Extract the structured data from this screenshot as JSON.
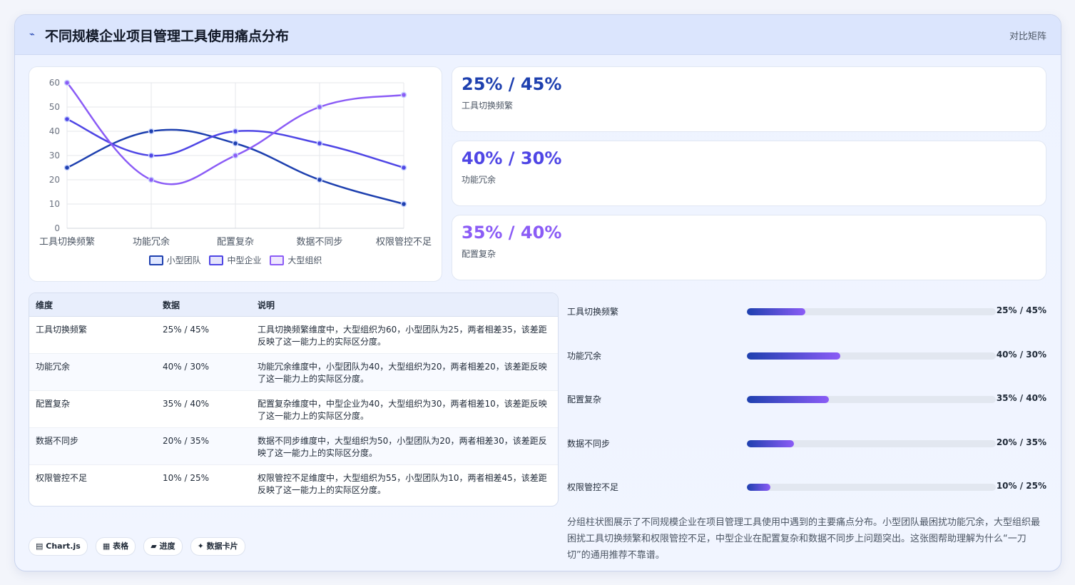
{
  "header": {
    "icon": "⌁",
    "title": "不同规模企业项目管理工具使用痛点分布",
    "right_label": "对比矩阵"
  },
  "chart_data": {
    "type": "line",
    "categories": [
      "工具切换频繁",
      "功能冗余",
      "配置复杂",
      "数据不同步",
      "权限管控不足"
    ],
    "series": [
      {
        "name": "小型团队",
        "values": [
          25,
          40,
          35,
          20,
          10
        ],
        "color": "#1e40af"
      },
      {
        "name": "中型企业",
        "values": [
          45,
          30,
          40,
          35,
          25
        ],
        "color": "#4f46e5"
      },
      {
        "name": "大型组织",
        "values": [
          60,
          20,
          30,
          50,
          55
        ],
        "color": "#8b5cf6"
      }
    ],
    "ylim": [
      0,
      60
    ],
    "yticks": [
      "0",
      "10",
      "20",
      "30",
      "40",
      "50",
      "60"
    ],
    "grid": true,
    "smooth": true,
    "legend_position": "bottom"
  },
  "stats": [
    {
      "value": "25% / 45%",
      "label": "工具切换频繁",
      "color": "#1e40af"
    },
    {
      "value": "40% / 30%",
      "label": "功能冗余",
      "color": "#4f46e5"
    },
    {
      "value": "35% / 40%",
      "label": "配置复杂",
      "color": "#8b5cf6"
    }
  ],
  "table": {
    "headers": [
      "维度",
      "数据",
      "说明"
    ],
    "rows": [
      {
        "dim": "工具切换频繁",
        "data": "25% / 45%",
        "desc": "工具切换频繁维度中，大型组织为60，小型团队为25，两者相差35，该差距反映了这一能力上的实际区分度。"
      },
      {
        "dim": "功能冗余",
        "data": "40% / 30%",
        "desc": "功能冗余维度中，小型团队为40，大型组织为20，两者相差20，该差距反映了这一能力上的实际区分度。"
      },
      {
        "dim": "配置复杂",
        "data": "35% / 40%",
        "desc": "配置复杂维度中，中型企业为40，大型组织为30，两者相差10，该差距反映了这一能力上的实际区分度。"
      },
      {
        "dim": "数据不同步",
        "data": "20% / 35%",
        "desc": "数据不同步维度中，大型组织为50，小型团队为20，两者相差30，该差距反映了这一能力上的实际区分度。"
      },
      {
        "dim": "权限管控不足",
        "data": "10% / 25%",
        "desc": "权限管控不足维度中，大型组织为55，小型团队为10，两者相差45，该差距反映了这一能力上的实际区分度。"
      }
    ]
  },
  "progress": [
    {
      "label": "工具切换频繁",
      "value": "25% / 45%",
      "fill": 0.235
    },
    {
      "label": "功能冗余",
      "value": "40% / 30%",
      "fill": 0.375
    },
    {
      "label": "配置复杂",
      "value": "35% / 40%",
      "fill": 0.33
    },
    {
      "label": "数据不同步",
      "value": "20% / 35%",
      "fill": 0.19
    },
    {
      "label": "权限管控不足",
      "value": "10% / 25%",
      "fill": 0.095
    }
  ],
  "description": "分组柱状图展示了不同规模企业在项目管理工具使用中遇到的主要痛点分布。小型团队最困扰功能冗余，大型组织最困扰工具切换频繁和权限管控不足，中型企业在配置复杂和数据不同步上问题突出。这张图帮助理解为什么“一刀切”的通用推荐不靠谱。",
  "tags": [
    {
      "icon": "▤",
      "label": "Chart.js"
    },
    {
      "icon": "▦",
      "label": "表格"
    },
    {
      "icon": "▰",
      "label": "进度"
    },
    {
      "icon": "✦",
      "label": "数据卡片"
    }
  ]
}
